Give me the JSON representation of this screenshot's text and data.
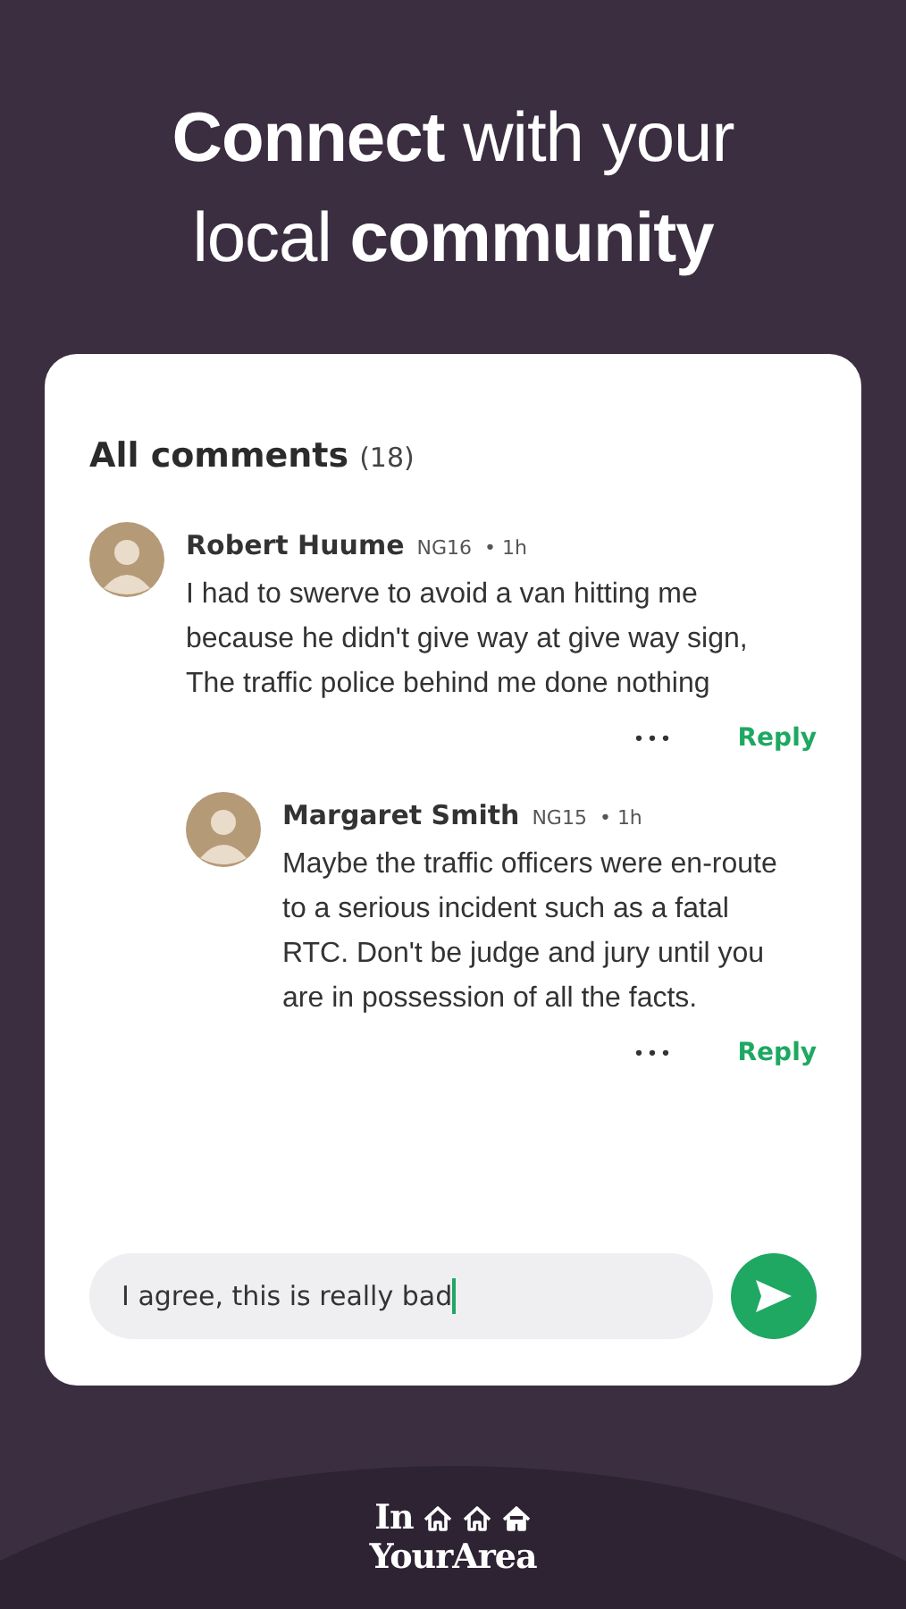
{
  "headline": [
    "**Connect** with your",
    "local **community**"
  ],
  "comments_header": {
    "title": "All comments",
    "count": "(18)"
  },
  "comments": [
    {
      "author": "Robert Huume",
      "area": "NG16",
      "time": "• 1h",
      "text": "I had to swerve to avoid a van hitting me because he didn't give way at give way sign, The traffic police behind me done nothing",
      "more": "•••",
      "reply": "Reply",
      "children": [
        {
          "author": "Margaret Smith",
          "area": "NG15",
          "time": "• 1h",
          "text": "Maybe the traffic officers were en-route to a serious incident such as a fatal RTC. Don't be judge and jury until you are in possession of all the facts.",
          "more": "•••",
          "reply": "Reply"
        }
      ]
    }
  ],
  "composer": {
    "value": "I agree, this is really bad"
  },
  "logo": {
    "line_1": "In",
    "line_2": "YourArea"
  }
}
